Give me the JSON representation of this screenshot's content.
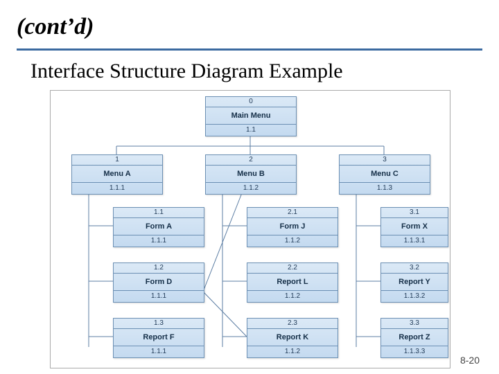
{
  "header": "(cont’d)",
  "subtitle": "Interface Structure Diagram Example",
  "page_number": "8-20",
  "nodes": {
    "main": {
      "id": "0",
      "title": "Main Menu",
      "ref": "1.1"
    },
    "menuA": {
      "id": "1",
      "title": "Menu A",
      "ref": "1.1.1"
    },
    "menuB": {
      "id": "2",
      "title": "Menu B",
      "ref": "1.1.2"
    },
    "menuC": {
      "id": "3",
      "title": "Menu C",
      "ref": "1.1.3"
    },
    "formA": {
      "id": "1.1",
      "title": "Form A",
      "ref": "1.1.1"
    },
    "formD": {
      "id": "1.2",
      "title": "Form D",
      "ref": "1.1.1"
    },
    "reportF": {
      "id": "1.3",
      "title": "Report F",
      "ref": "1.1.1"
    },
    "formJ": {
      "id": "2.1",
      "title": "Form J",
      "ref": "1.1.2"
    },
    "reportL": {
      "id": "2.2",
      "title": "Report L",
      "ref": "1.1.2"
    },
    "reportK": {
      "id": "2.3",
      "title": "Report K",
      "ref": "1.1.2"
    },
    "formX": {
      "id": "3.1",
      "title": "Form X",
      "ref": "1.1.3.1"
    },
    "reportY": {
      "id": "3.2",
      "title": "Report Y",
      "ref": "1.1.3.2"
    },
    "reportZ": {
      "id": "3.3",
      "title": "Report Z",
      "ref": "1.1.3.3"
    }
  }
}
